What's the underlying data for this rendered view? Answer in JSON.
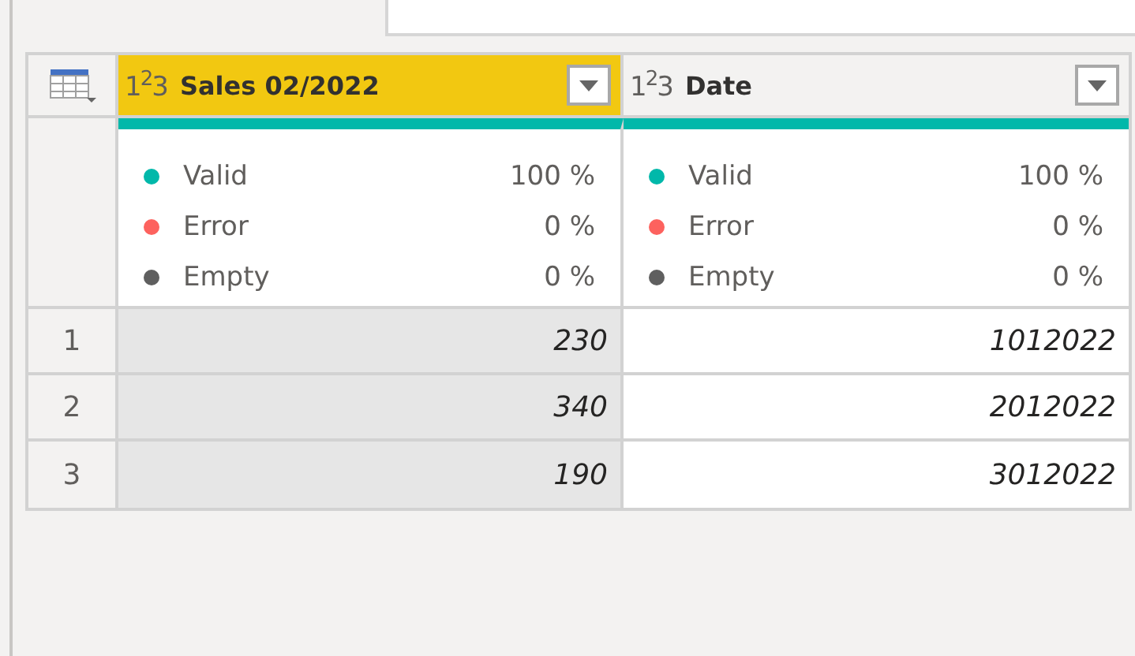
{
  "columns": [
    {
      "type_icon": "1$^{2}$3",
      "title": "Sales 02/2022",
      "selected": true,
      "quality": [
        {
          "label": "Valid",
          "value": "100 %",
          "color": "#01b8aa"
        },
        {
          "label": "Error",
          "value": "0 %",
          "color": "#fd625e"
        },
        {
          "label": "Empty",
          "value": "0 %",
          "color": "#5f5f5f"
        }
      ]
    },
    {
      "type_icon": "1$^{2}$3",
      "title": "Date",
      "selected": false,
      "quality": [
        {
          "label": "Valid",
          "value": "100 %",
          "color": "#01b8aa"
        },
        {
          "label": "Error",
          "value": "0 %",
          "color": "#fd625e"
        },
        {
          "label": "Empty",
          "value": "0 %",
          "color": "#5f5f5f"
        }
      ]
    }
  ],
  "rows": [
    {
      "number": "1",
      "cells": [
        "230",
        "1012022"
      ]
    },
    {
      "number": "2",
      "cells": [
        "340",
        "2012022"
      ]
    },
    {
      "number": "3",
      "cells": [
        "190",
        "3012022"
      ]
    }
  ]
}
